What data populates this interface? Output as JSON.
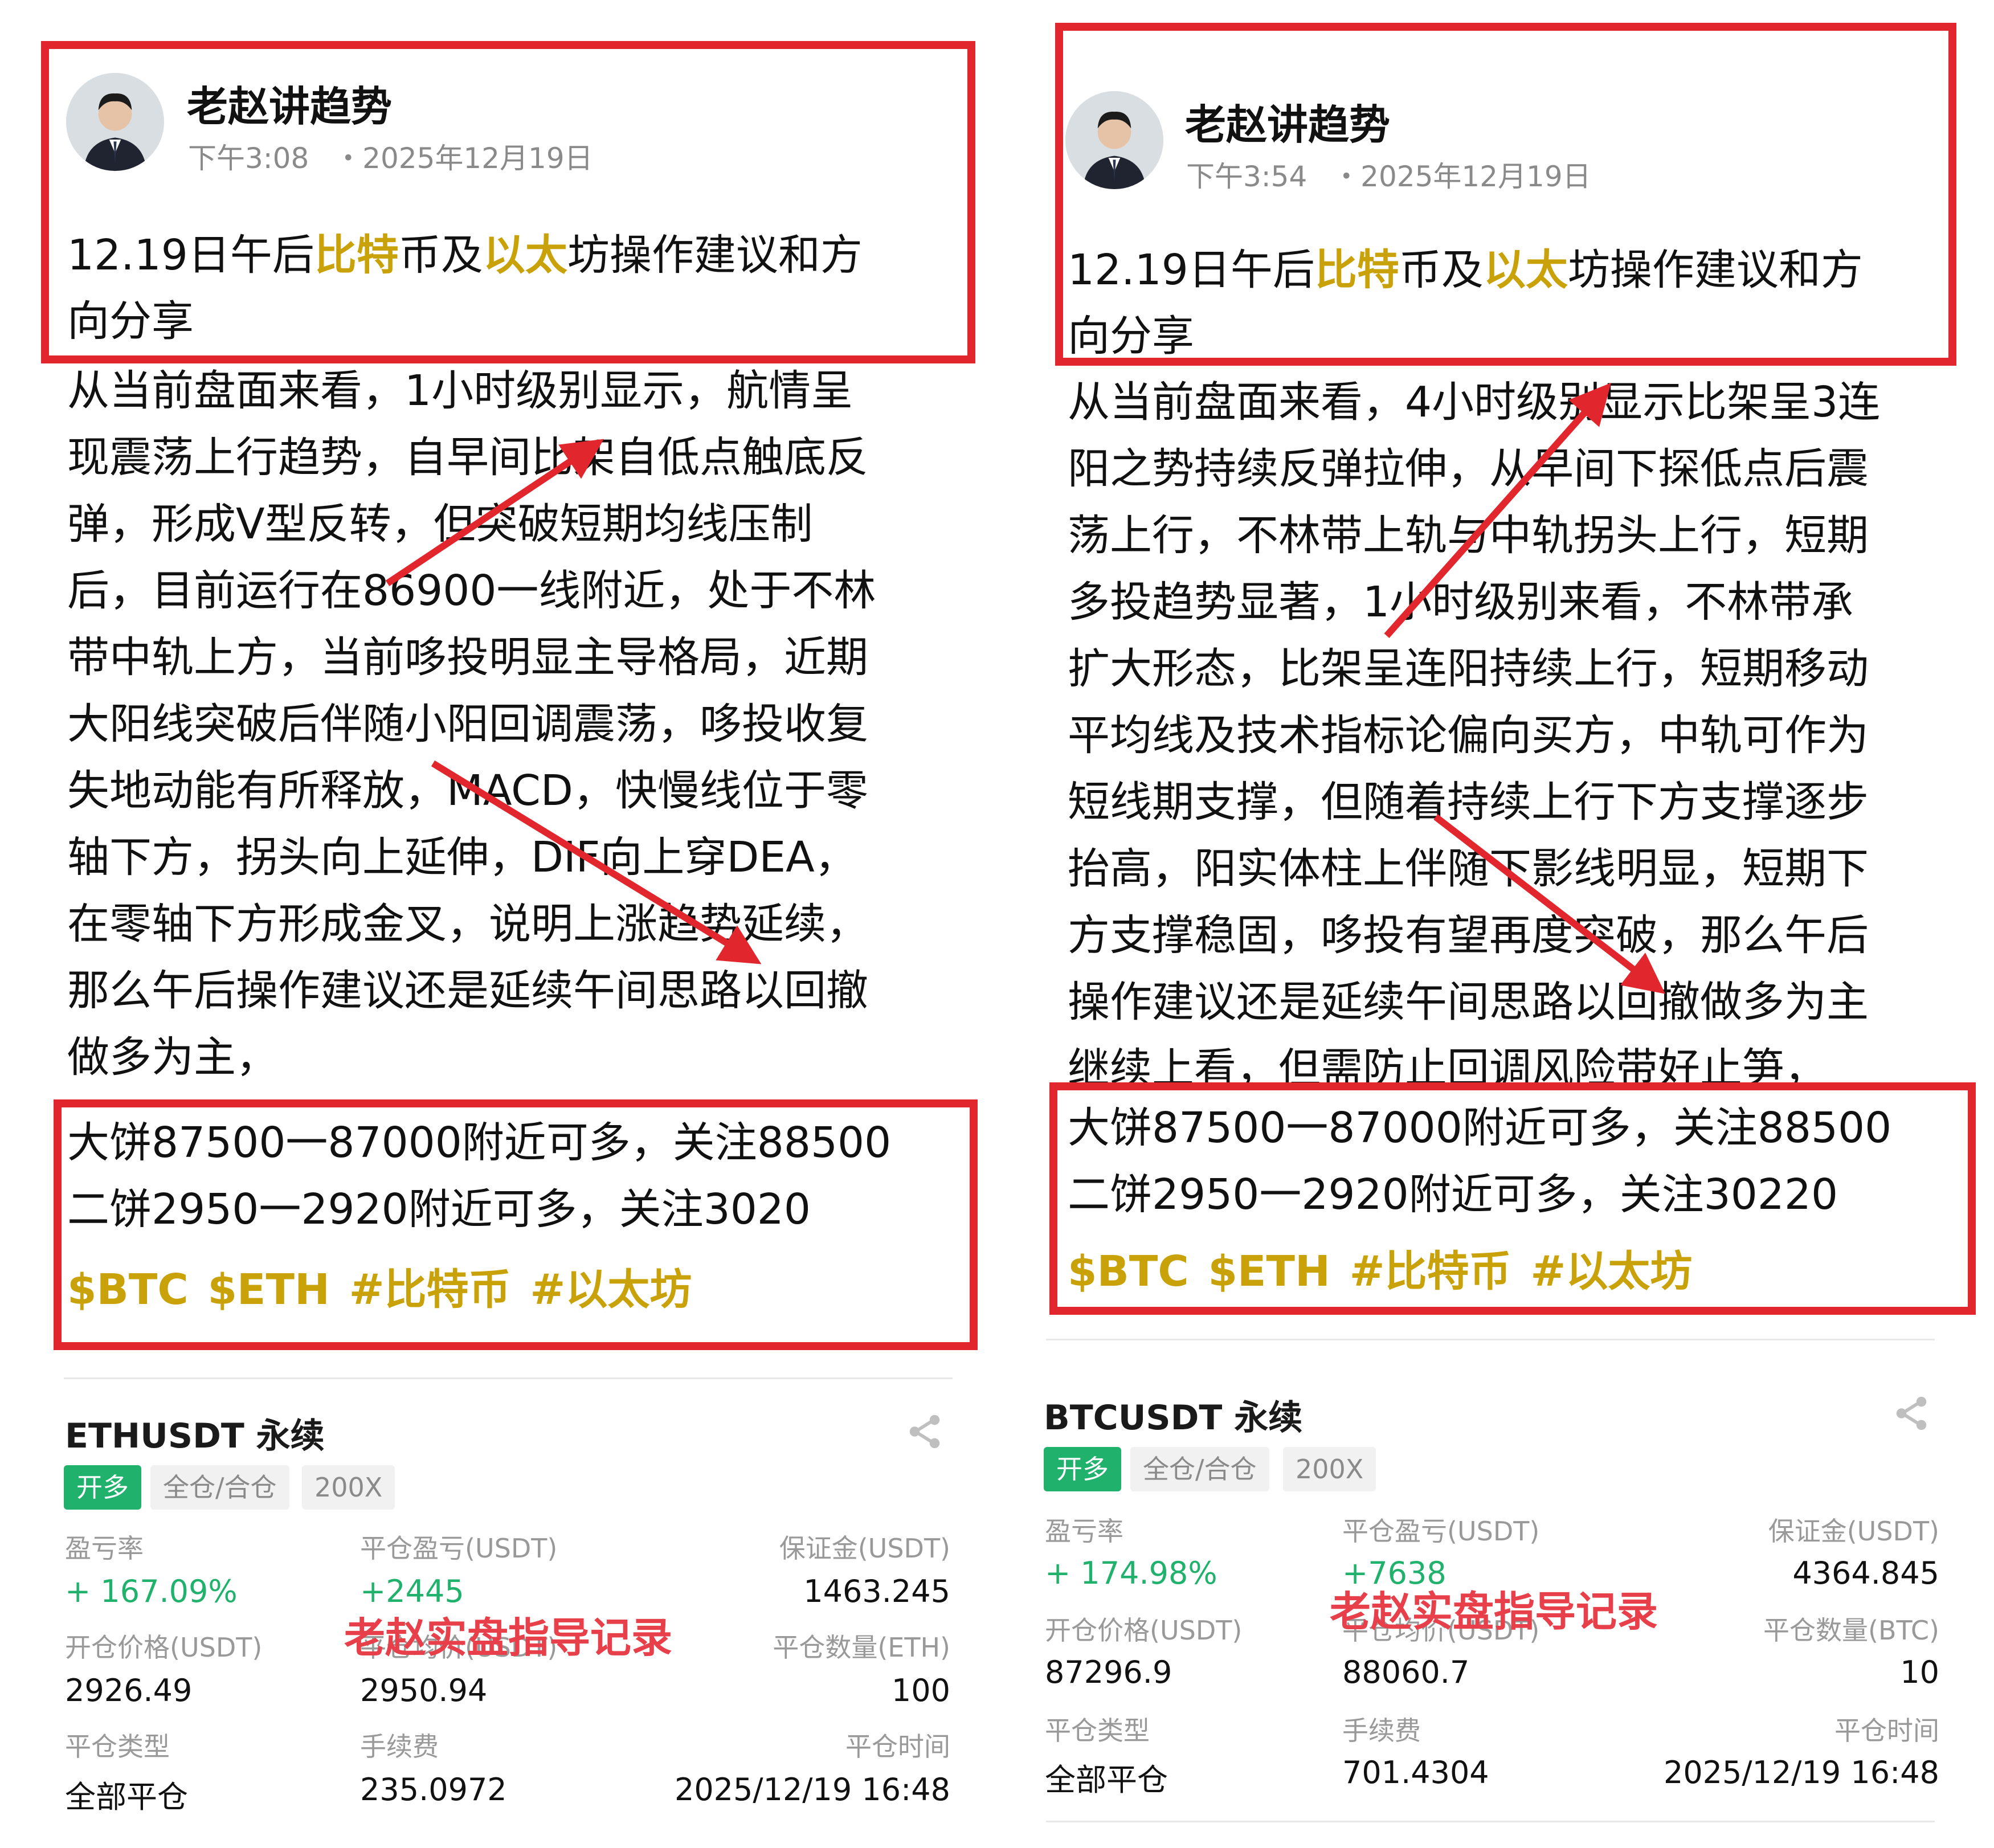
{
  "colors": {
    "highlight": "#c9a20a",
    "red_box": "#e1262d",
    "green": "#20b26c",
    "watermark": "#e8404a"
  },
  "left": {
    "author": "老赵讲趋势",
    "time": "下午3:08",
    "date": "・2025年12月19日",
    "title": {
      "p1": "12.19日午后",
      "h1": "比特",
      "p2": "币及",
      "h2": "以太",
      "p3": "坊操作建议和方",
      "p4": "向分享"
    },
    "body": "从当前盘面来看，1小时级别显示，航情呈\n现震荡上行趋势，自早间比架自低点触底反\n弹，形成V型反转，但突破短期均线压制\n后，目前运行在86900一线附近，处于不林\n带中轨上方，当前哆投明显主导格局，近期\n大阳线突破后伴随小阳回调震荡，哆投收复\n失地动能有所释放，MACD，快慢线位于零\n轴下方，拐头向上延伸，DIF向上穿DEA，\n在零轴下方形成金叉，说明上涨趋势延续，\n那么午后操作建议还是延续午间思路以回撤\n做多为主，",
    "advice": "大饼87500一87000附近可多，关注88500\n二饼2950一2920附近可多，关注3020",
    "tags": "$BTC $ETH #比特币 #以太坊",
    "card": {
      "title": "ETHUSDT 永续",
      "badges": [
        "开多",
        "全仓/合仓",
        "200X"
      ],
      "labels": {
        "pnl_rate": "盈亏率",
        "close_pnl": "平仓盈亏(USDT)",
        "margin": "保证金(USDT)",
        "open_price": "开仓价格(USDT)",
        "close_avg": "平仓均价(USDT)",
        "close_qty": "平仓数量(ETH)",
        "close_type": "平仓类型",
        "fee": "手续费",
        "close_time": "平仓时间"
      },
      "values": {
        "pnl_rate": "+ 167.09%",
        "close_pnl": "+2445",
        "margin": "1463.245",
        "open_price": "2926.49",
        "close_avg": "2950.94",
        "close_qty": "100",
        "close_type": "全部平仓",
        "fee": "235.0972",
        "close_time": "2025/12/19 16:48"
      },
      "watermark": "老赵实盘指导记录"
    }
  },
  "right": {
    "author": "老赵讲趋势",
    "time": "下午3:54",
    "date": "・2025年12月19日",
    "title": {
      "p1": "12.19日午后",
      "h1": "比特",
      "p2": "币及",
      "h2": "以太",
      "p3": "坊操作建议和方",
      "p4": "向分享"
    },
    "body": "从当前盘面来看，4小时级别显示比架呈3连\n阳之势持续反弹拉伸，从早间下探低点后震\n荡上行，不林带上轨与中轨拐头上行，短期\n多投趋势显著，1小时级别来看，不林带承\n扩大形态，比架呈连阳持续上行，短期移动\n平均线及技术指标论偏向买方，中轨可作为\n短线期支撑，但随着持续上行下方支撑逐步\n抬高，阳实体柱上伴随下影线明显，短期下\n方支撑稳固，哆投有望再度突破，那么午后\n操作建议还是延续午间思路以回撤做多为主\n继续上看，但需防止回调风险带好止笋，",
    "advice": "大饼87500一87000附近可多，关注88500\n二饼2950一2920附近可多，关注30220",
    "tags": "$BTC $ETH #比特币 #以太坊",
    "card": {
      "title": "BTCUSDT 永续",
      "badges": [
        "开多",
        "全仓/合仓",
        "200X"
      ],
      "labels": {
        "pnl_rate": "盈亏率",
        "close_pnl": "平仓盈亏(USDT)",
        "margin": "保证金(USDT)",
        "open_price": "开仓价格(USDT)",
        "close_avg": "平仓均价(USDT)",
        "close_qty": "平仓数量(BTC)",
        "close_type": "平仓类型",
        "fee": "手续费",
        "close_time": "平仓时间"
      },
      "values": {
        "pnl_rate": "+ 174.98%",
        "close_pnl": "+7638",
        "margin": "4364.845",
        "open_price": "87296.9",
        "close_avg": "88060.7",
        "close_qty": "10",
        "close_type": "全部平仓",
        "fee": "701.4304",
        "close_time": "2025/12/19 16:48"
      },
      "watermark": "老赵实盘指导记录"
    }
  }
}
